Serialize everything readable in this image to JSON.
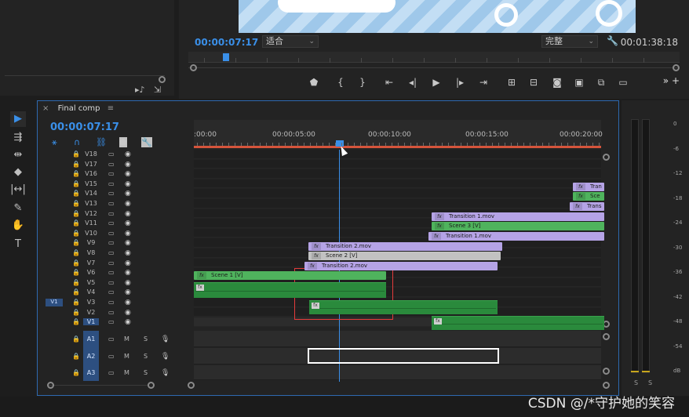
{
  "program_monitor": {
    "timecode": "00:00:07:17",
    "fit_select": "适合",
    "quality_select": "完整",
    "duration": "00:01:38:18"
  },
  "timeline": {
    "tab_close": "×",
    "sequence_name": "Final comp",
    "tab_menu": "≡",
    "timecode": "00:00:07:17",
    "ruler_labels": [
      ":00:00",
      "00:00:05:00",
      "00:00:10:00",
      "00:00:15:00",
      "00:00:20:00"
    ],
    "video_tracks": [
      "V18",
      "V17",
      "V16",
      "V15",
      "V14",
      "V13",
      "V12",
      "V11",
      "V10",
      "V9",
      "V8",
      "V7",
      "V6",
      "V5",
      "V4",
      "V3",
      "V2",
      "V1"
    ],
    "audio_tracks": [
      "A1",
      "A2",
      "A3"
    ],
    "source_patch": "V1",
    "audio_controls": {
      "mute": "M",
      "solo": "S"
    },
    "clips": {
      "transition_1_a": "Transition 1.mov",
      "scene_3": "Scene 3 [V]",
      "transition_1_b": "Transition 1.mov",
      "transition_2_a": "Transition 2.mov",
      "scene_2": "Scene 2 [V]",
      "transition_2_b": "Transition 2.mov",
      "scene_1": "Scene 1 [V]",
      "trans_top_1": "Tran",
      "trans_top_2": "Sce",
      "trans_top_3": "Trans"
    }
  },
  "audio_meter": {
    "db_labels": [
      "0",
      "-6",
      "-12",
      "-18",
      "-24",
      "-30",
      "-36",
      "-42",
      "-48",
      "-54",
      "dB"
    ],
    "solo_labels": [
      "S",
      "S"
    ]
  },
  "watermark": "CSDN @/*守护她的笑容"
}
